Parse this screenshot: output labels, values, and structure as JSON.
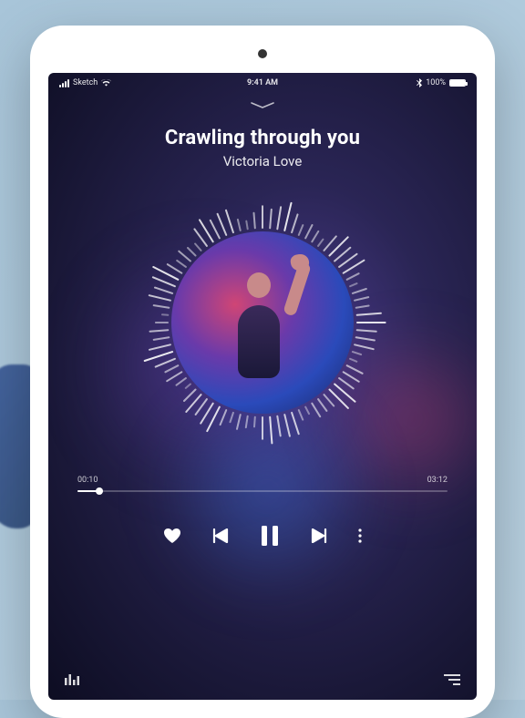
{
  "statusBar": {
    "carrier": "Sketch",
    "time": "9:41 AM",
    "battery": "100%"
  },
  "player": {
    "title": "Crawling through you",
    "artist": "Victoria Love",
    "elapsed": "00:10",
    "duration": "03:12",
    "progressPercent": 6
  },
  "icons": {
    "wifi": "wifi-icon",
    "bluetooth": "bluetooth-icon",
    "collapse": "chevron-down-icon",
    "heart": "heart-icon",
    "previous": "previous-icon",
    "pause": "pause-icon",
    "next": "next-icon",
    "more": "more-icon",
    "equalizer": "equalizer-icon",
    "menu": "menu-icon"
  }
}
